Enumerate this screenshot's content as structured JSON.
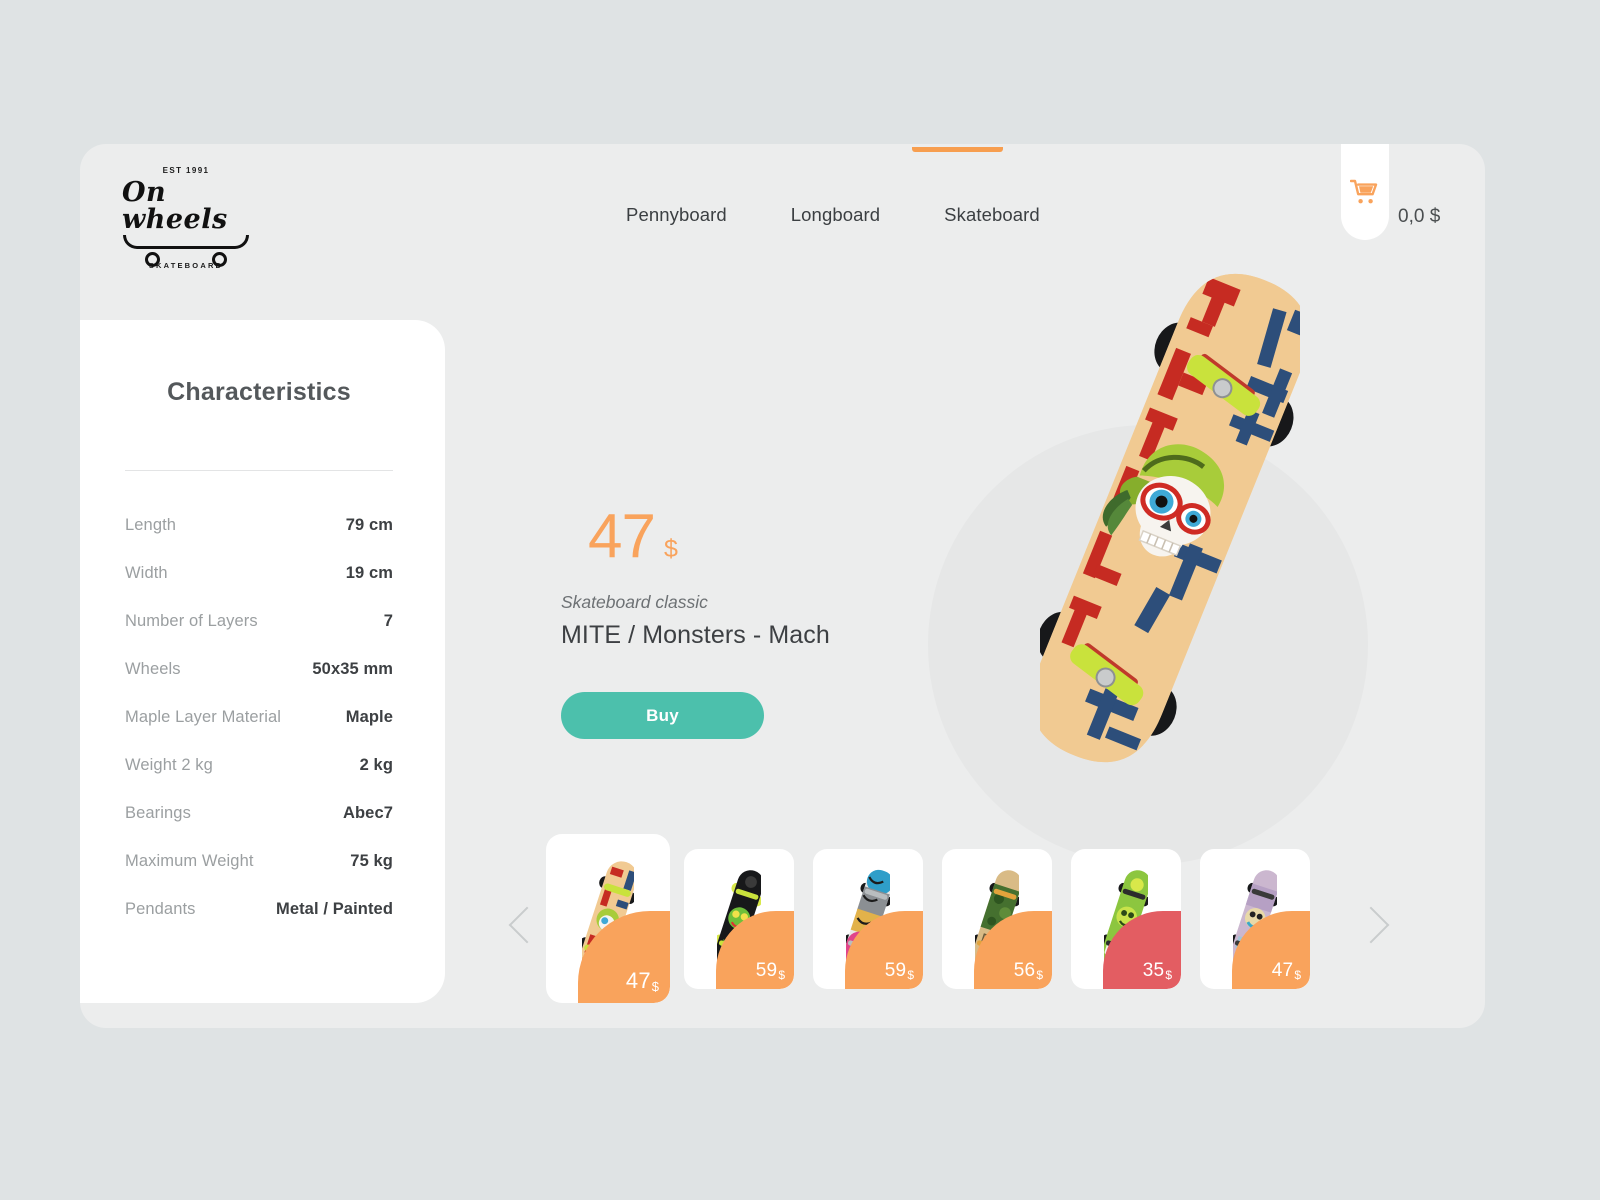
{
  "theme": {
    "page_bg": "#dfe3e4",
    "panel_bg": "#eceded",
    "accent_orange": "#f79e4f",
    "accent_teal": "#4cc0ac",
    "sale_red": "#e35d62",
    "text_dark": "#3d4043",
    "text_muted": "#9b9fa1"
  },
  "header": {
    "logo": {
      "established": "EST 1991",
      "name": "On wheels",
      "subtitle": "SKATEBOARD"
    },
    "nav": [
      {
        "label": "Pennyboard",
        "active": false
      },
      {
        "label": "Longboard",
        "active": false
      },
      {
        "label": "Skateboard",
        "active": true
      }
    ],
    "cart": {
      "icon": "shopping-cart-icon",
      "total": "0,0 $"
    }
  },
  "characteristics": {
    "title": "Characteristics",
    "rows": [
      {
        "label": "Length",
        "value": "79 cm"
      },
      {
        "label": "Width",
        "value": "19 cm"
      },
      {
        "label": "Number of Layers",
        "value": "7"
      },
      {
        "label": "Wheels",
        "value": "50x35 mm"
      },
      {
        "label": "Maple Layer Material",
        "value": "Maple"
      },
      {
        "label": "Weight 2 kg",
        "value": "2 kg"
      },
      {
        "label": "Bearings",
        "value": "Abec7"
      },
      {
        "label": "Maximum Weight",
        "value": "75 kg"
      },
      {
        "label": "Pendants",
        "value": "Metal / Painted"
      }
    ]
  },
  "product": {
    "price_amount": "47",
    "price_currency": "$",
    "category": "Skateboard classic",
    "title": "MITE / Monsters - Mach",
    "buy_label": "Buy",
    "image_alt": "skateboard-hero-image"
  },
  "carousel": {
    "prev_icon": "chevron-left-icon",
    "next_icon": "chevron-right-icon",
    "items": [
      {
        "price": "47",
        "currency": "$",
        "badge_color": "#f9a35c",
        "active": true,
        "deck": "tan-skull-graffiti"
      },
      {
        "price": "59",
        "currency": "$",
        "badge_color": "#f9a35c",
        "active": false,
        "deck": "black-green-monster"
      },
      {
        "price": "59",
        "currency": "$",
        "badge_color": "#f9a35c",
        "active": false,
        "deck": "blue-tiger-stripe"
      },
      {
        "price": "56",
        "currency": "$",
        "badge_color": "#f9a35c",
        "active": false,
        "deck": "green-camo"
      },
      {
        "price": "35",
        "currency": "$",
        "badge_color": "#e35d62",
        "active": false,
        "deck": "lime-green-toxic"
      },
      {
        "price": "47",
        "currency": "$",
        "badge_color": "#f9a35c",
        "active": false,
        "deck": "pastel-creature"
      }
    ]
  }
}
